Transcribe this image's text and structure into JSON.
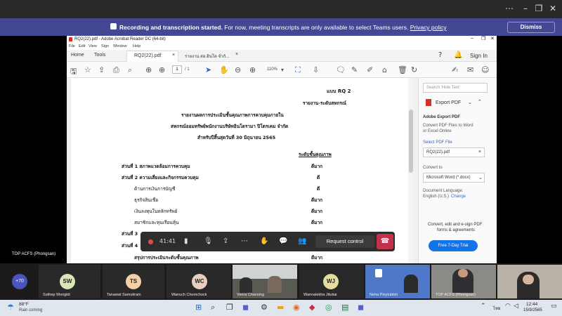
{
  "banner": {
    "title": "Recording and transcription started.",
    "message": " For now, meeting transcripts are only available to select Teams users.",
    "link": "Privacy policy",
    "dismiss": "Dismiss"
  },
  "acrobat": {
    "window_title": "RQ2(22).pdf - Adobe Acrobat Reader DC (64-bit)",
    "menu": [
      "File",
      "Edit",
      "View",
      "Sign",
      "Window",
      "Help"
    ],
    "tabs": [
      "Home",
      "Tools",
      "RQ2(22).pdf",
      "รายงาน สอ.อินโด จำกั..."
    ],
    "signin": "Sign In",
    "page_current": "1",
    "page_total": "/ 1",
    "zoom": "110%",
    "document": {
      "form": "แบบ RQ 2",
      "report_type": "รายงาน-ระดับสหกรณ์",
      "title1": "รายงานผลการประเมินชั้นคุณภาพการควบคุมภายใน",
      "title2": "สหกรณ์ออมทรัพย์พนักงานบริษัทอินโดรามา ปิโตรเคม จำกัด",
      "title3": "สำหรับปีสิ้นสุดวันที่ 30 มิถุนายน 2565",
      "col_header": "ระดับชั้นคุณภาพ",
      "rows": [
        {
          "label": "ส่วนที่ 1 สภาพแวดล้อมการควบคุม",
          "grade": "ดีมาก"
        },
        {
          "label": "ส่วนที่ 2 ความเสี่ยงและกิจกรรมควบคุม",
          "grade": "ดี"
        },
        {
          "label": "ด้านการเงินการบัญชี",
          "grade": "ดี"
        },
        {
          "label": "ธุรกิจสินเชื่อ",
          "grade": "ดีมาก"
        },
        {
          "label": "เงินลงทุนในหลักทรัพย์",
          "grade": "ดีมาก"
        },
        {
          "label": "สมาชิกและทุนเรือนหุ้น",
          "grade": "ดีมาก"
        },
        {
          "label": "ส่วนที่ 3",
          "grade": ""
        },
        {
          "label": "ส่วนที่ 4",
          "grade": ""
        },
        {
          "label": "สรุปการประเมินระดับชั้นคุณภาพ",
          "grade": "ดีมาก"
        }
      ]
    },
    "panel": {
      "search_placeholder": "Search 'Hide Text'",
      "export_label": "Export PDF",
      "heading": "Adobe Export PDF",
      "desc1": "Convert PDF Files to Word",
      "desc2": "or Excel Online",
      "select_file": "Select PDF File",
      "file_name": "RQ2(22).pdf",
      "convert_to": "Convert to",
      "format": "Microsoft Word (*.docx)",
      "doc_lang": "Document Language:",
      "lang_value": "English (U.S.)",
      "change": "Change",
      "promo1": "Convert, edit and e-sign PDF",
      "promo2": "forms & agreements",
      "trial": "Free 7-Day Trial"
    }
  },
  "meeting": {
    "timer": "41:41",
    "request_control": "Request control",
    "presenter": "TOP ACFS (Phongsan)",
    "overflow": "+70",
    "participants": [
      {
        "initials": "SW",
        "name": "Suthep Wongkit",
        "color": "#d9e6b8"
      },
      {
        "initials": "TS",
        "name": "Tanawat Samutiram",
        "color": "#f4cfa8"
      },
      {
        "initials": "WC",
        "name": "Wanuch Chomchock",
        "color": "#e9cfc0"
      },
      {
        "initials": "",
        "name": "Veera Chansing",
        "color": ""
      },
      {
        "initials": "WJ",
        "name": "Wannalekha Jitutiai",
        "color": "#e4dca0"
      },
      {
        "initials": "",
        "name": "Neha Pleytubtim",
        "color": ""
      },
      {
        "initials": "",
        "name": "TOP ACFS (Phongsan)",
        "color": ""
      }
    ]
  },
  "taskbar": {
    "weather_temp": "88°F",
    "weather_desc": "Rain coming",
    "lang": "ไทย",
    "time": "12:44",
    "date": "15/9/2565"
  }
}
